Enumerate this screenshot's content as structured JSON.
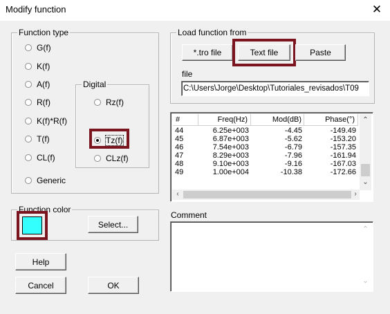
{
  "window": {
    "title": "Modify function",
    "close_glyph": "✕"
  },
  "function_type": {
    "legend": "Function type",
    "options": [
      "G(f)",
      "K(f)",
      "A(f)",
      "R(f)",
      "K(f)*R(f)",
      "T(f)",
      "CL(f)",
      "Generic"
    ],
    "digital": {
      "legend": "Digital",
      "options": [
        "Rz(f)",
        "Tz(f)",
        "CLz(f)"
      ],
      "selected": "Tz(f)"
    }
  },
  "load_from": {
    "legend": "Load function from",
    "buttons": {
      "tro": "*.tro file",
      "text": "Text file",
      "paste": "Paste"
    },
    "file_label": "file",
    "file_path": "C:\\Users\\Jorge\\Desktop\\Tutoriales_revisados\\T09"
  },
  "table": {
    "headers": [
      "#",
      "Freq(Hz)",
      "Mod(dB)",
      "Phase(°)"
    ],
    "rows": [
      [
        "44",
        "6.25e+003",
        "-4.45",
        "-149.49"
      ],
      [
        "45",
        "6.87e+003",
        "-5.62",
        "-153.20"
      ],
      [
        "46",
        "7.54e+003",
        "-6.79",
        "-157.35"
      ],
      [
        "47",
        "8.29e+003",
        "-7.96",
        "-161.94"
      ],
      [
        "48",
        "9.10e+003",
        "-9.16",
        "-167.03"
      ],
      [
        "49",
        "1.00e+004",
        "-10.38",
        "-172.66"
      ]
    ]
  },
  "function_color": {
    "legend": "Function color",
    "color": "#33ffff",
    "select_label": "Select..."
  },
  "comment": {
    "label": "Comment",
    "value": ""
  },
  "buttons": {
    "help": "Help",
    "cancel": "Cancel",
    "ok": "OK"
  },
  "highlight_color": "#7a1520"
}
